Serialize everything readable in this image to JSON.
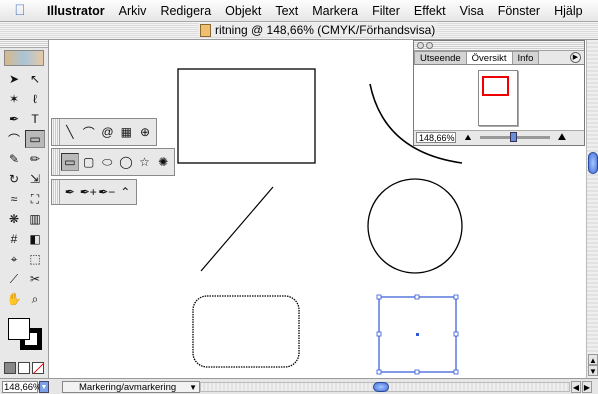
{
  "menubar": {
    "apple_icon": "apple-icon",
    "app_name": "Illustrator",
    "items": [
      "Arkiv",
      "Redigera",
      "Objekt",
      "Text",
      "Markera",
      "Filter",
      "Effekt",
      "Visa",
      "Fönster",
      "Hjälp"
    ]
  },
  "window": {
    "title": "ritning @ 148,66% (CMYK/Förhandsvisa)"
  },
  "toolbox": {
    "tools": [
      {
        "name": "selection-tool",
        "glyph": "➤"
      },
      {
        "name": "direct-selection-tool",
        "glyph": "↖"
      },
      {
        "name": "magic-wand-tool",
        "glyph": "✶"
      },
      {
        "name": "lasso-tool",
        "glyph": "ℓ"
      },
      {
        "name": "pen-tool",
        "glyph": "✒"
      },
      {
        "name": "type-tool",
        "glyph": "T"
      },
      {
        "name": "arc-tool",
        "glyph": "⌒"
      },
      {
        "name": "rectangle-tool",
        "glyph": "▭"
      },
      {
        "name": "paintbrush-tool",
        "glyph": "✎"
      },
      {
        "name": "pencil-tool",
        "glyph": "✏"
      },
      {
        "name": "rotate-tool",
        "glyph": "↻"
      },
      {
        "name": "scale-tool",
        "glyph": "⇲"
      },
      {
        "name": "warp-tool",
        "glyph": "≈"
      },
      {
        "name": "free-transform-tool",
        "glyph": "⛶"
      },
      {
        "name": "symbol-sprayer-tool",
        "glyph": "❋"
      },
      {
        "name": "graph-tool",
        "glyph": "▥"
      },
      {
        "name": "mesh-tool",
        "glyph": "#"
      },
      {
        "name": "gradient-tool",
        "glyph": "◧"
      },
      {
        "name": "eyedropper-tool",
        "glyph": "⌖"
      },
      {
        "name": "blend-tool",
        "glyph": "⬚"
      },
      {
        "name": "slice-tool",
        "glyph": "⟋"
      },
      {
        "name": "scissors-tool",
        "glyph": "✂"
      },
      {
        "name": "hand-tool",
        "glyph": "✋"
      },
      {
        "name": "zoom-tool",
        "glyph": "⌕"
      }
    ],
    "active_tool": "rectangle-tool"
  },
  "flyouts": {
    "line_tools": [
      "╲",
      "⌒",
      "@",
      "▦",
      "⊕"
    ],
    "shape_tools": [
      "▭",
      "▢",
      "⬭",
      "◯",
      "☆",
      "✺"
    ],
    "pen_tools": [
      "✒",
      "✒+",
      "✒−",
      "⌃"
    ]
  },
  "navigator": {
    "tabs": [
      "Utseende",
      "Översikt",
      "Info"
    ],
    "active_tab": "Översikt",
    "zoom": "148,66%"
  },
  "statusbar": {
    "zoom": "148,66%",
    "status": "Markering/avmarkering"
  },
  "colors": {
    "selection": "#2f57d6",
    "nav_view": "#e00000"
  }
}
